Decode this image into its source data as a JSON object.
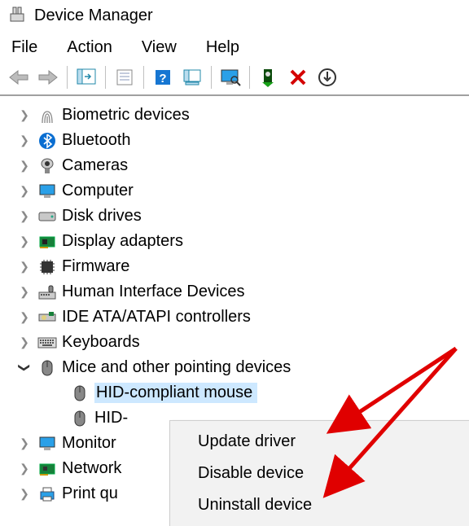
{
  "window": {
    "title": "Device Manager"
  },
  "menu": {
    "file": "File",
    "action": "Action",
    "view": "View",
    "help": "Help"
  },
  "tree": {
    "items": [
      {
        "label": "Biometric devices"
      },
      {
        "label": "Bluetooth"
      },
      {
        "label": "Cameras"
      },
      {
        "label": "Computer"
      },
      {
        "label": "Disk drives"
      },
      {
        "label": "Display adapters"
      },
      {
        "label": "Firmware"
      },
      {
        "label": "Human Interface Devices"
      },
      {
        "label": "IDE ATA/ATAPI controllers"
      },
      {
        "label": "Keyboards"
      },
      {
        "label": "Mice and other pointing devices"
      },
      {
        "label": "Monitor"
      },
      {
        "label": "Network"
      },
      {
        "label": "Print qu"
      }
    ],
    "mice_children": [
      {
        "label": "HID-compliant mouse"
      },
      {
        "label": "HID-"
      }
    ]
  },
  "context_menu": {
    "update": "Update driver",
    "disable": "Disable device",
    "uninstall": "Uninstall device"
  }
}
